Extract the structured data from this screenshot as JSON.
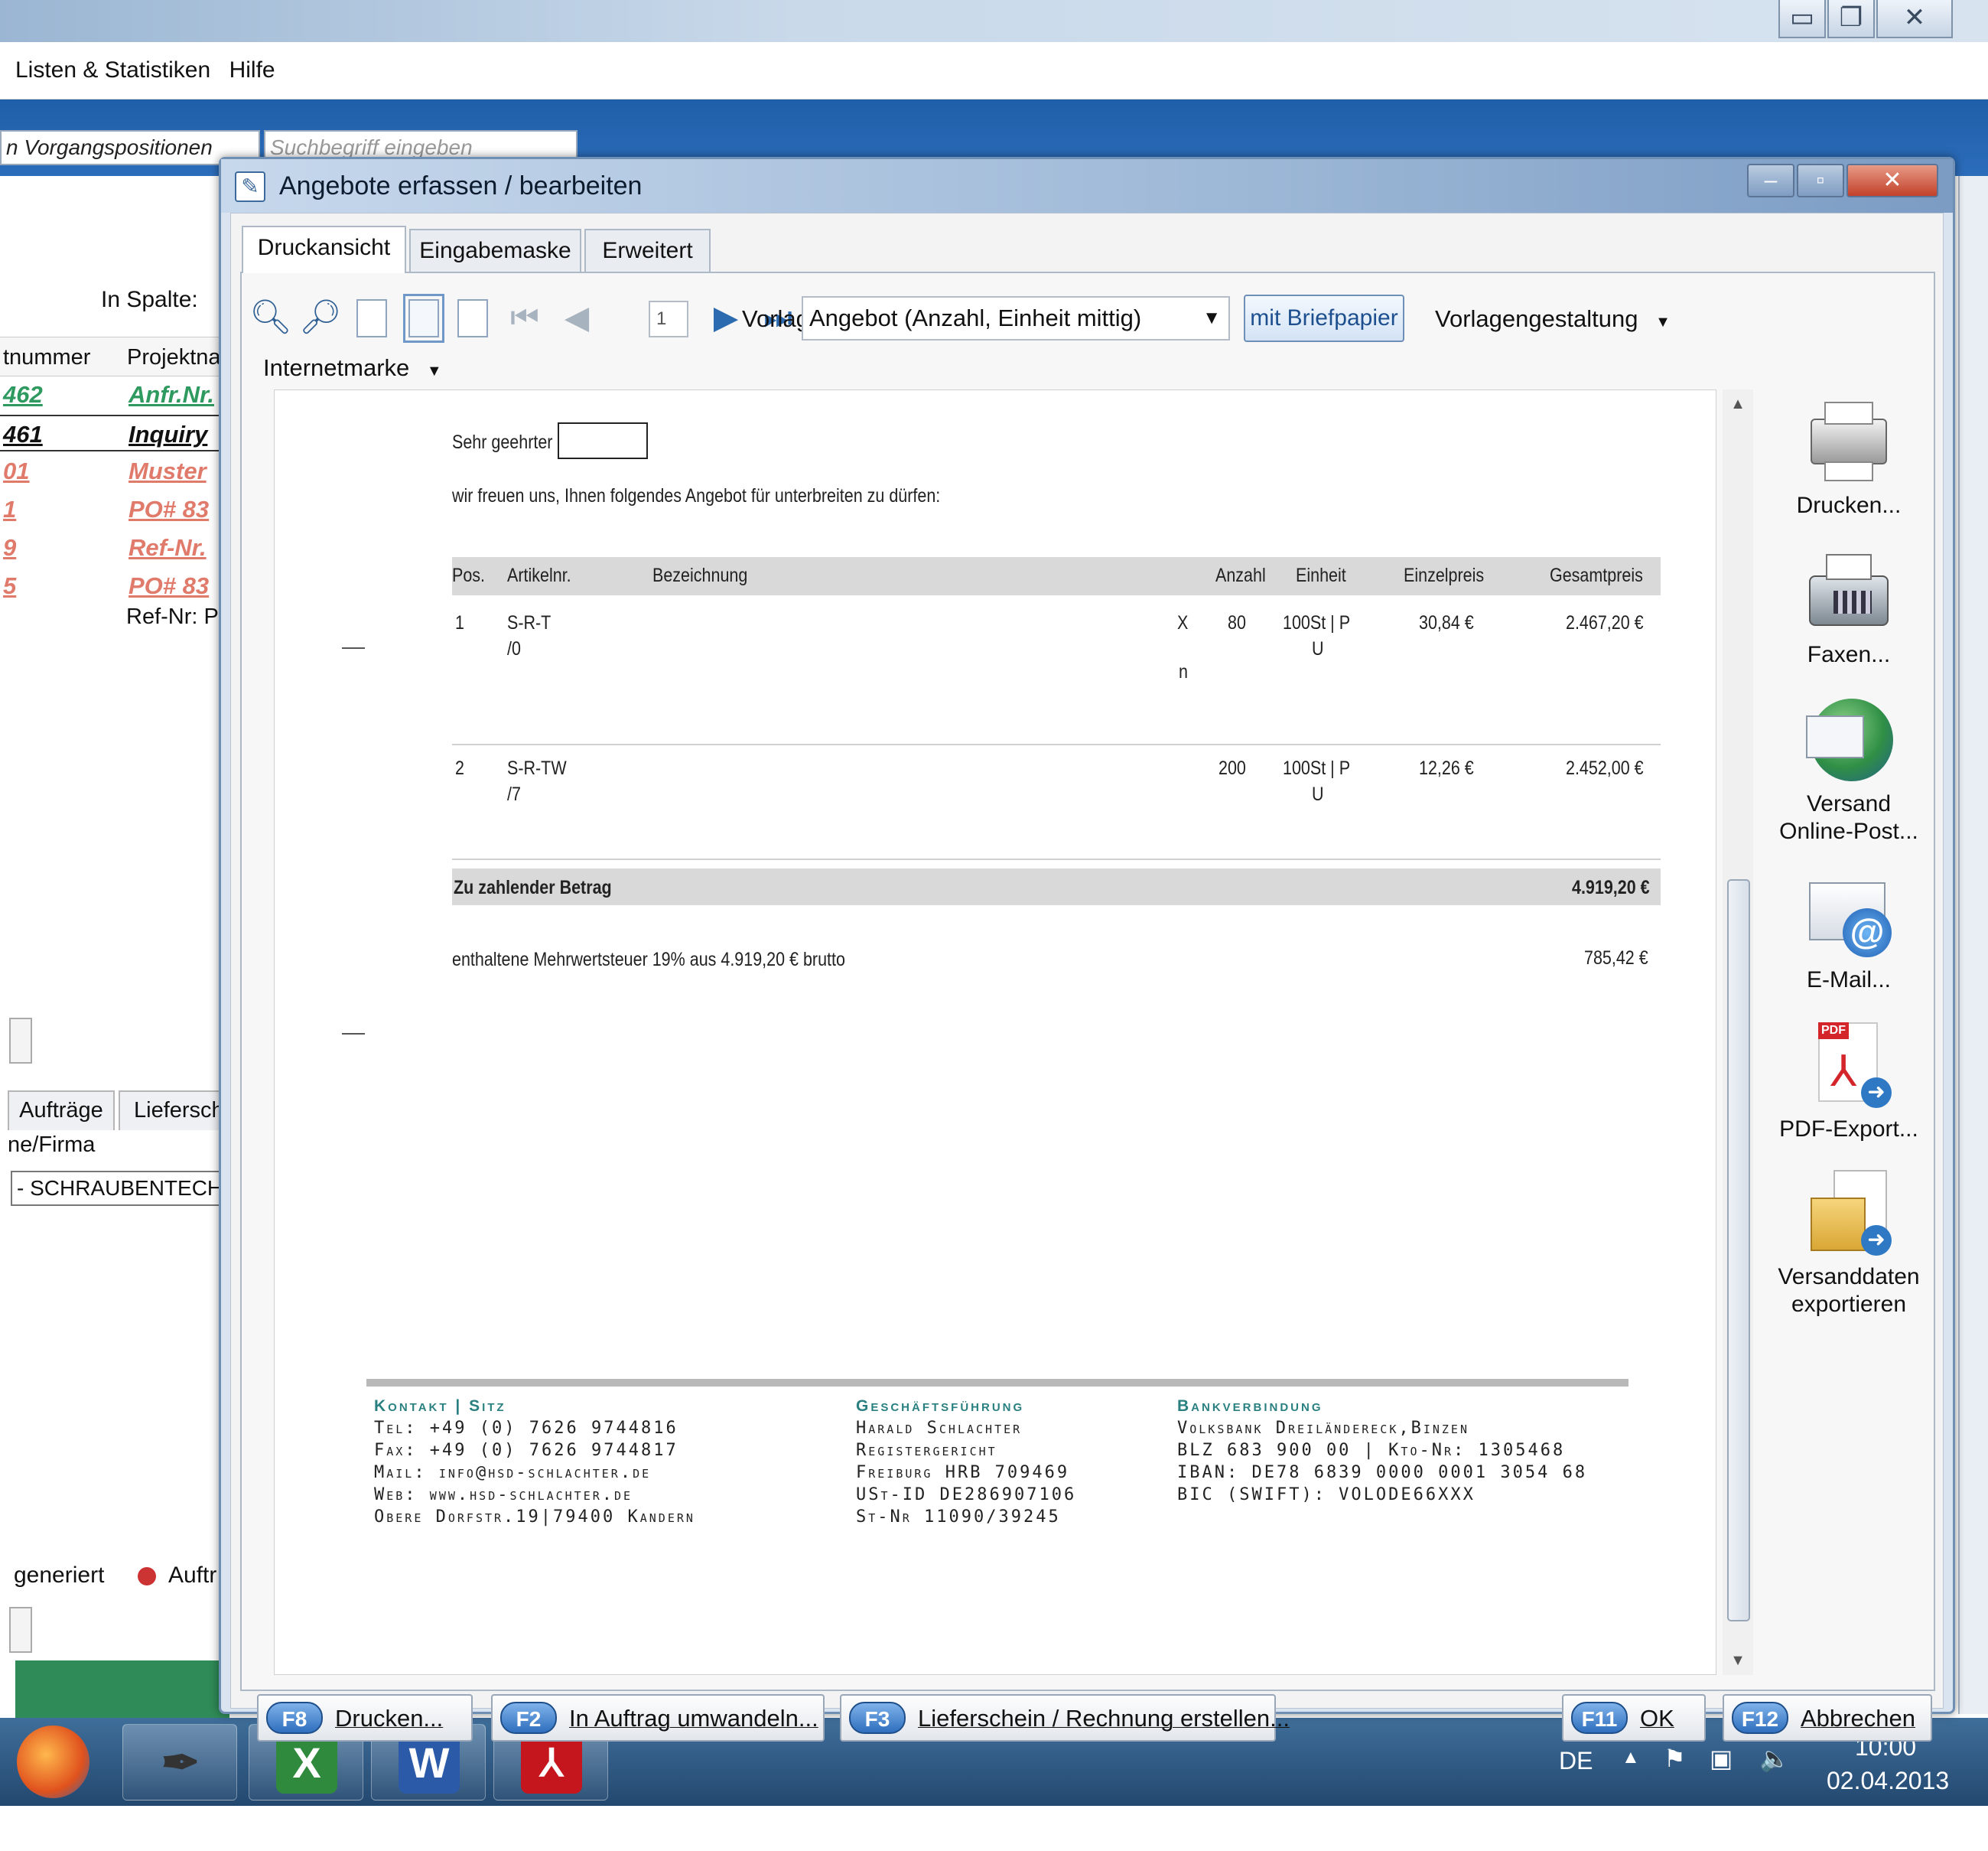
{
  "background_app": {
    "menu": [
      "Listen & Statistiken",
      "Hilfe"
    ],
    "search_scope": "n Vorgangspositionen",
    "search_placeholder": "Suchbegriff eingeben",
    "column_filter_label": "In Spalte:",
    "columns": [
      "tnummer",
      "Projektna"
    ],
    "rows": [
      {
        "number": "462",
        "project": "Anfr.Nr.",
        "color": "#2f9a5f"
      },
      {
        "number": "461",
        "project": "Inquiry",
        "color": "#111111"
      },
      {
        "number": "01",
        "project": "Muster",
        "color": "#e07a6b"
      },
      {
        "number": "1",
        "project": "PO# 83",
        "color": "#e07a6b"
      },
      {
        "number": "9",
        "project": "Ref-Nr.",
        "color": "#e07a6b"
      },
      {
        "number": "5",
        "project": "PO# 83",
        "color": "#e07a6b"
      }
    ],
    "ref_text": "Ref-Nr: P",
    "lower_tabs": [
      "Aufträge",
      "Liefersch"
    ],
    "lower_header": "ne/Firma",
    "lower_value": "- SCHRAUBENTECHN",
    "status_left": "generiert",
    "status_right": "Auftr"
  },
  "dialog": {
    "title": "Angebote erfassen / bearbeiten",
    "tabs": [
      "Druckansicht",
      "Eingabemaske",
      "Erweitert"
    ],
    "toolbar": {
      "page_number": "1",
      "vorlage_label": "Vorlage:",
      "vorlage_value": "Angebot (Anzahl, Einheit mittig)",
      "briefpapier_button": "mit Briefpapier",
      "vorlagengestaltung": "Vorlagengestaltung",
      "internetmarke": "Internetmarke"
    },
    "document": {
      "salutation": "Sehr geehrter",
      "intro": "wir freuen uns, Ihnen folgendes Angebot für unterbreiten zu dürfen:",
      "headers": [
        "Pos.",
        "Artikelnr.",
        "Bezeichnung",
        "Anzahl",
        "Einheit",
        "Einzelpreis",
        "Gesamtpreis"
      ],
      "items": [
        {
          "pos": "1",
          "artikel_1": "S-R-T",
          "artikel_2": "/0",
          "mark_1": "X",
          "mark_2": "n",
          "anzahl": "80",
          "einheit_1": "100St | P",
          "einheit_2": "U",
          "einzelpreis": "30,84 €",
          "gesamtpreis": "2.467,20 €"
        },
        {
          "pos": "2",
          "artikel_1": "S-R-TW",
          "artikel_2": "/7",
          "anzahl": "200",
          "einheit_1": "100St | P",
          "einheit_2": "U",
          "einzelpreis": "12,26 €",
          "gesamtpreis": "2.452,00 €"
        }
      ],
      "total_label": "Zu zahlender Betrag",
      "total_value": "4.919,20 €",
      "vat_text": "enthaltene Mehrwertsteuer 19% aus 4.919,20 € brutto",
      "vat_value": "785,42 €",
      "footer": {
        "kontakt_head": "Kontakt | Sitz",
        "kontakt_lines": [
          "Tel:  +49 (0) 7626 9744816",
          "Fax:  +49 (0) 7626 9744817",
          "Mail: info@hsd-schlachter.de",
          "Web: www.hsd-schlachter.de",
          "Obere Dorfstr.19|79400 Kandern"
        ],
        "gf_head": "Geschäftsführung",
        "gf_lines": [
          "Harald Schlachter",
          "Registergericht",
          "Freiburg HRB 709469",
          "USt-ID DE286907106",
          "St-Nr 11090/39245"
        ],
        "bank_head": "Bankverbindung",
        "bank_lines": [
          "Volksbank Dreiländereck,Binzen",
          "BLZ 683 900 00 | Kto-Nr: 1305468",
          "IBAN: DE78 6839 0000 0001 3054 68",
          "BIC (SWIFT): VOLODE66XXX"
        ]
      }
    },
    "side_actions": [
      {
        "label": "Drucken...",
        "icon": "printer-icon"
      },
      {
        "label": "Faxen...",
        "icon": "fax-icon"
      },
      {
        "label": "Versand Online-Post...",
        "icon": "online-post-icon"
      },
      {
        "label": "E-Mail...",
        "icon": "email-icon"
      },
      {
        "label": "PDF-Export...",
        "icon": "pdf-export-icon"
      },
      {
        "label": "Versanddaten exportieren",
        "icon": "export-data-icon"
      }
    ],
    "buttons": [
      {
        "key": "F8",
        "label": "Drucken..."
      },
      {
        "key": "F2",
        "label": "In Auftrag umwandeln..."
      },
      {
        "key": "F3",
        "label": "Lieferschein / Rechnung erstellen..."
      },
      {
        "key": "F11",
        "label": "OK"
      },
      {
        "key": "F12",
        "label": "Abbrechen"
      }
    ]
  },
  "taskbar": {
    "language": "DE",
    "time": "10:00",
    "date": "02.04.2013"
  }
}
